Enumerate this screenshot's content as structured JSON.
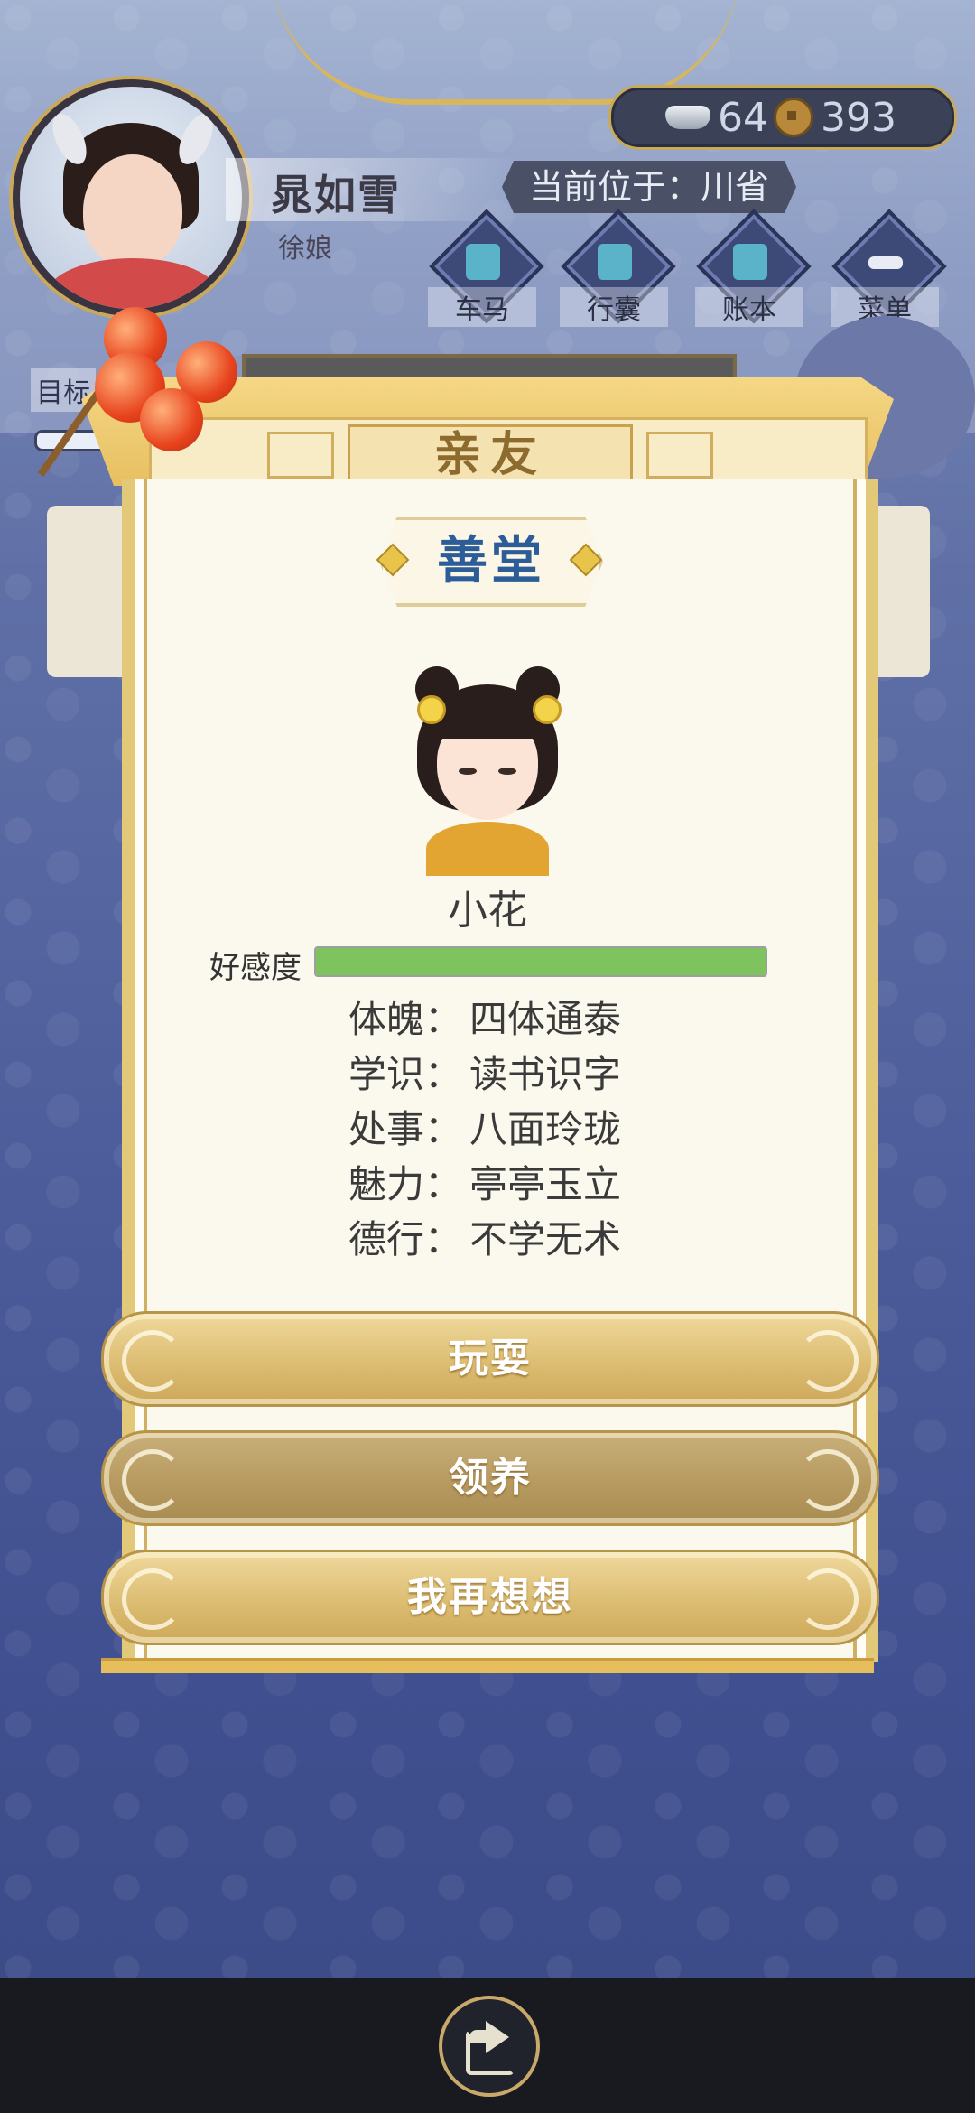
{
  "header": {
    "player_name": "晁如雪",
    "player_role": "徐娘",
    "silver": "64",
    "copper": "393",
    "location": "当前位于：川省",
    "target_label": "目标"
  },
  "nav": [
    {
      "label": "车马",
      "icon": "carriage-icon"
    },
    {
      "label": "行囊",
      "icon": "bag-icon"
    },
    {
      "label": "账本",
      "icon": "ledger-icon"
    },
    {
      "label": "菜单",
      "icon": "menu-dots-icon"
    }
  ],
  "modal": {
    "title": "亲友",
    "place_name": "善堂",
    "child_name": "小花",
    "affinity_label": "好感度",
    "affinity_fraction": 1.0,
    "stats": [
      {
        "key": "体魄：",
        "value": "四体通泰"
      },
      {
        "key": "学识：",
        "value": "读书识字"
      },
      {
        "key": "处事：",
        "value": "八面玲珑"
      },
      {
        "key": "魅力：",
        "value": "亭亭玉立"
      },
      {
        "key": "德行：",
        "value": "不学无术"
      }
    ],
    "buttons": {
      "play": "玩耍",
      "adopt": "领养",
      "reconsider": "我再想想"
    }
  },
  "colors": {
    "accent_gold": "#dcbd72",
    "affinity_green": "#7ec35e",
    "title_blue": "#2d5d98"
  }
}
